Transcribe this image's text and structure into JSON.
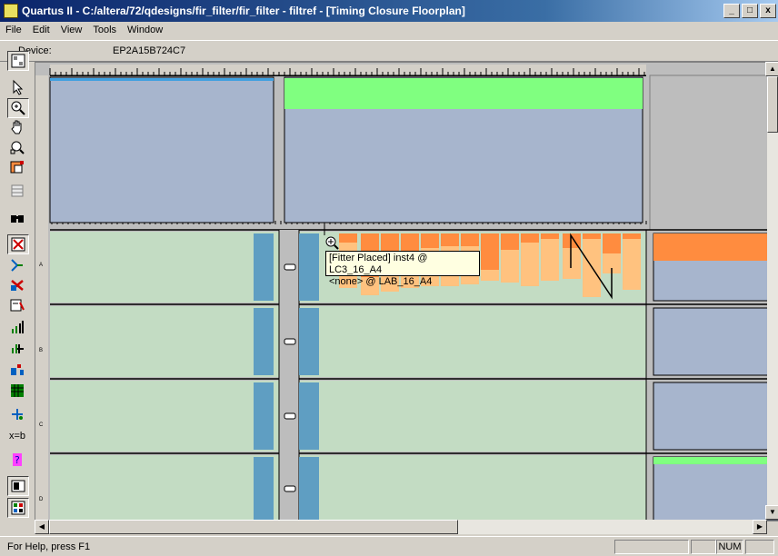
{
  "window": {
    "title": "Quartus II - C:/altera/72/qdesigns/fir_filter/fir_filter - filtref - [Timing Closure Floorplan]",
    "controls": [
      "_",
      "□",
      "x"
    ]
  },
  "menu": [
    "File",
    "Edit",
    "View",
    "Tools",
    "Window"
  ],
  "device": {
    "label": "Device:",
    "value": "EP2A15B724C7"
  },
  "toolbar_icons": [
    "floorplan-icon",
    "pointer-icon",
    "zoom-icon",
    "hand-icon",
    "search-zoom-icon",
    "color-legend-icon",
    "grid-icon",
    "find-icon",
    "assignment-icon",
    "routing-icon",
    "delete-assignment-icon",
    "node-properties-icon",
    "fan-in-icon",
    "fan-out-icon",
    "path-icon",
    "lab-icon",
    "pins-icon",
    "equation-icon",
    "help-icon",
    "layer-icon",
    "layer-settings-icon"
  ],
  "toolbar_equation_label": "x=b",
  "row_labels": [
    "A",
    "B",
    "C",
    "D"
  ],
  "tooltip": {
    "line1": "[Fitter Placed] inst4 @ LC3_16_A4",
    "line2": "<none> @ LAB_16_A4"
  },
  "status": {
    "message": "For Help, press F1",
    "num": "NUM"
  },
  "colors": {
    "block_blue": "#a7b5cd",
    "block_green": "#c3dcc3",
    "column_blue": "#5f9ec2",
    "fill_orange": "#ff8c3f",
    "fill_light_orange": "#ffc27f",
    "header_green": "#80ff80"
  }
}
